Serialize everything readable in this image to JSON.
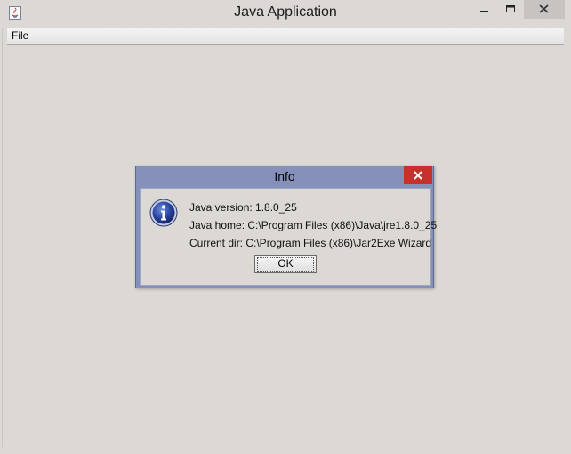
{
  "window": {
    "title": "Java Application",
    "icon": "java-app-icon"
  },
  "menubar": {
    "items": [
      {
        "label": "File"
      }
    ]
  },
  "dialog": {
    "title": "Info",
    "icon": "info-icon",
    "lines": [
      "Java version: 1.8.0_25",
      "Java home: C:\\Program Files (x86)\\Java\\jre1.8.0_25",
      "Current dir: C:\\Program Files (x86)\\Jar2Exe Wizard"
    ],
    "ok_label": "OK"
  },
  "colors": {
    "window_background": "#dcd8d4",
    "dialog_titlebar": "#8591bb",
    "dialog_close": "#c6312b"
  }
}
